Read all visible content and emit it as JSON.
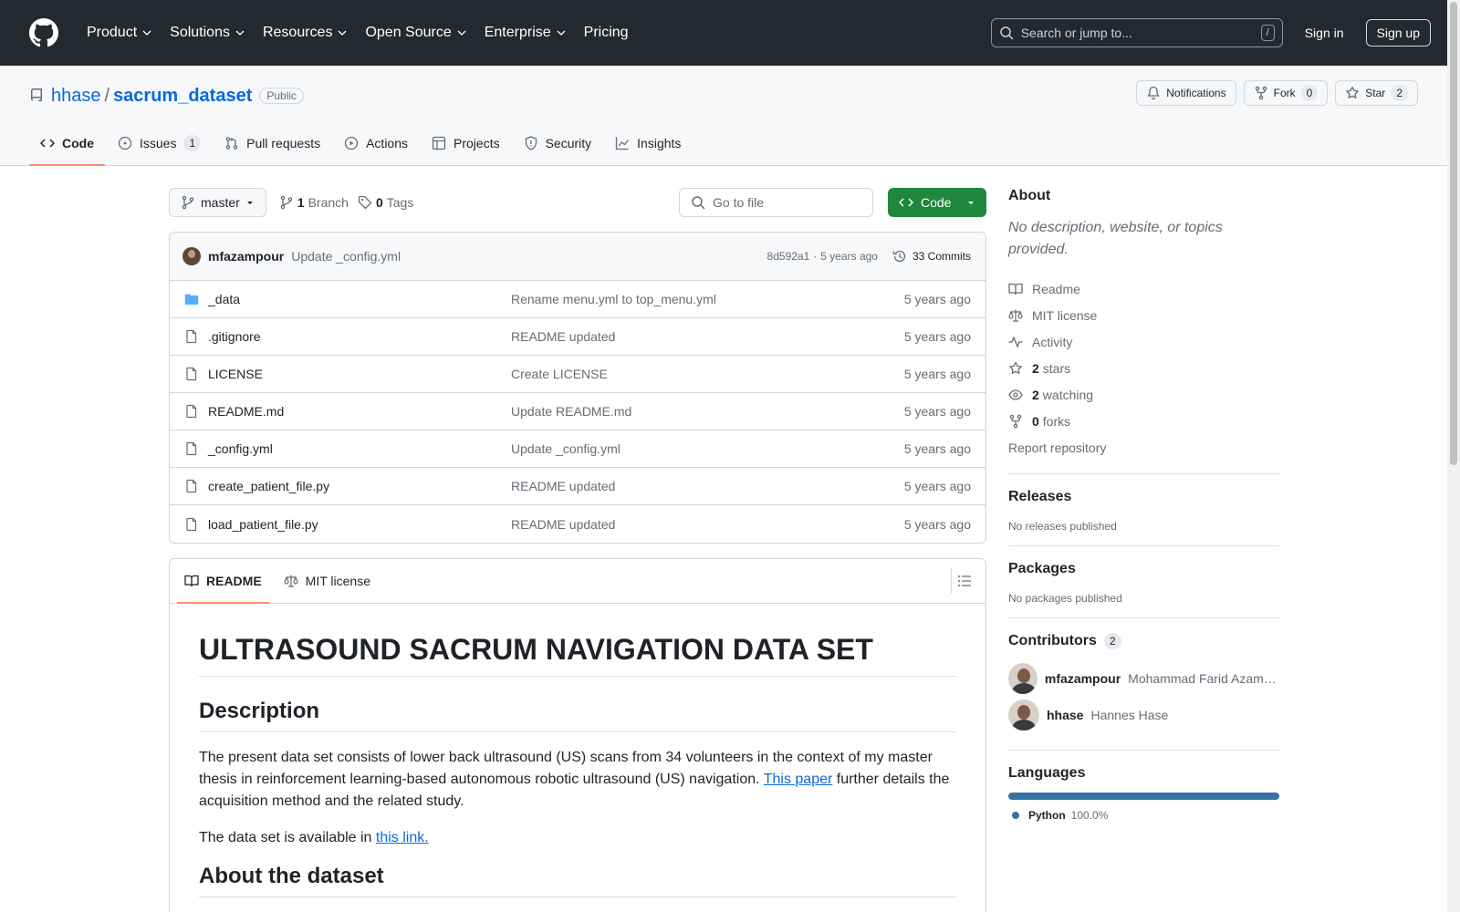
{
  "header": {
    "nav": [
      "Product",
      "Solutions",
      "Resources",
      "Open Source",
      "Enterprise",
      "Pricing"
    ],
    "search_placeholder": "Search or jump to...",
    "search_key": "/",
    "signin": "Sign in",
    "signup": "Sign up"
  },
  "repo": {
    "owner": "hhase",
    "separator": "/",
    "name": "sacrum_dataset",
    "visibility": "Public",
    "notifications": "Notifications",
    "fork_label": "Fork",
    "fork_count": "0",
    "star_label": "Star",
    "star_count": "2",
    "tabs": [
      {
        "label": "Code"
      },
      {
        "label": "Issues",
        "count": "1"
      },
      {
        "label": "Pull requests"
      },
      {
        "label": "Actions"
      },
      {
        "label": "Projects"
      },
      {
        "label": "Security"
      },
      {
        "label": "Insights"
      }
    ]
  },
  "filenav": {
    "branch": "master",
    "branch_count": "1",
    "branch_label": "Branch",
    "tag_count": "0",
    "tag_label": "Tags",
    "goto_placeholder": "Go to file",
    "code_button": "Code"
  },
  "commit": {
    "author": "mfazampour",
    "message": "Update _config.yml",
    "hash": "8d592a1",
    "dot": "·",
    "age": "5 years ago",
    "count_label": "33 Commits"
  },
  "files": [
    {
      "name": "_data",
      "type": "dir",
      "message": "Rename menu.yml to top_menu.yml",
      "age": "5 years ago"
    },
    {
      "name": ".gitignore",
      "type": "file",
      "message": "README updated",
      "age": "5 years ago"
    },
    {
      "name": "LICENSE",
      "type": "file",
      "message": "Create LICENSE",
      "age": "5 years ago"
    },
    {
      "name": "README.md",
      "type": "file",
      "message": "Update README.md",
      "age": "5 years ago"
    },
    {
      "name": "_config.yml",
      "type": "file",
      "message": "Update _config.yml",
      "age": "5 years ago"
    },
    {
      "name": "create_patient_file.py",
      "type": "file",
      "message": "README updated",
      "age": "5 years ago"
    },
    {
      "name": "load_patient_file.py",
      "type": "file",
      "message": "README updated",
      "age": "5 years ago"
    }
  ],
  "readme": {
    "tab_readme": "README",
    "tab_license": "MIT license",
    "h1": "ULTRASOUND SACRUM NAVIGATION DATA SET",
    "h2_description": "Description",
    "p1_before": "The present data set consists of lower back ultrasound (US) scans from 34 volunteers in the context of my master thesis in reinforcement learning-based autonomous robotic ultrasound (US) navigation. ",
    "p1_link": "This paper",
    "p1_after": " further details the acquisition method and the related study.",
    "p2_before": "The data set is available in ",
    "p2_link": "this link.",
    "h2_about": "About the dataset"
  },
  "sidebar": {
    "about_title": "About",
    "about_desc": "No description, website, or topics provided.",
    "links": {
      "readme": "Readme",
      "license": "MIT license",
      "activity": "Activity",
      "stars_count": "2",
      "stars_label": "stars",
      "watching_count": "2",
      "watching_label": "watching",
      "forks_count": "0",
      "forks_label": "forks",
      "report": "Report repository"
    },
    "releases_title": "Releases",
    "releases_empty": "No releases published",
    "packages_title": "Packages",
    "packages_empty": "No packages published",
    "contributors_title": "Contributors",
    "contributors_count": "2",
    "contributors": [
      {
        "login": "mfazampour",
        "name": "Mohammad Farid Azampour"
      },
      {
        "login": "hhase",
        "name": "Hannes Hase"
      }
    ],
    "languages_title": "Languages",
    "languages": [
      {
        "name": "Python",
        "percent": "100.0%",
        "color": "#3572A5"
      }
    ]
  },
  "colors": {
    "header_bg": "#24292f",
    "accent": "#0969da",
    "green": "#1f883d",
    "tab_underline": "#fd8c73"
  }
}
